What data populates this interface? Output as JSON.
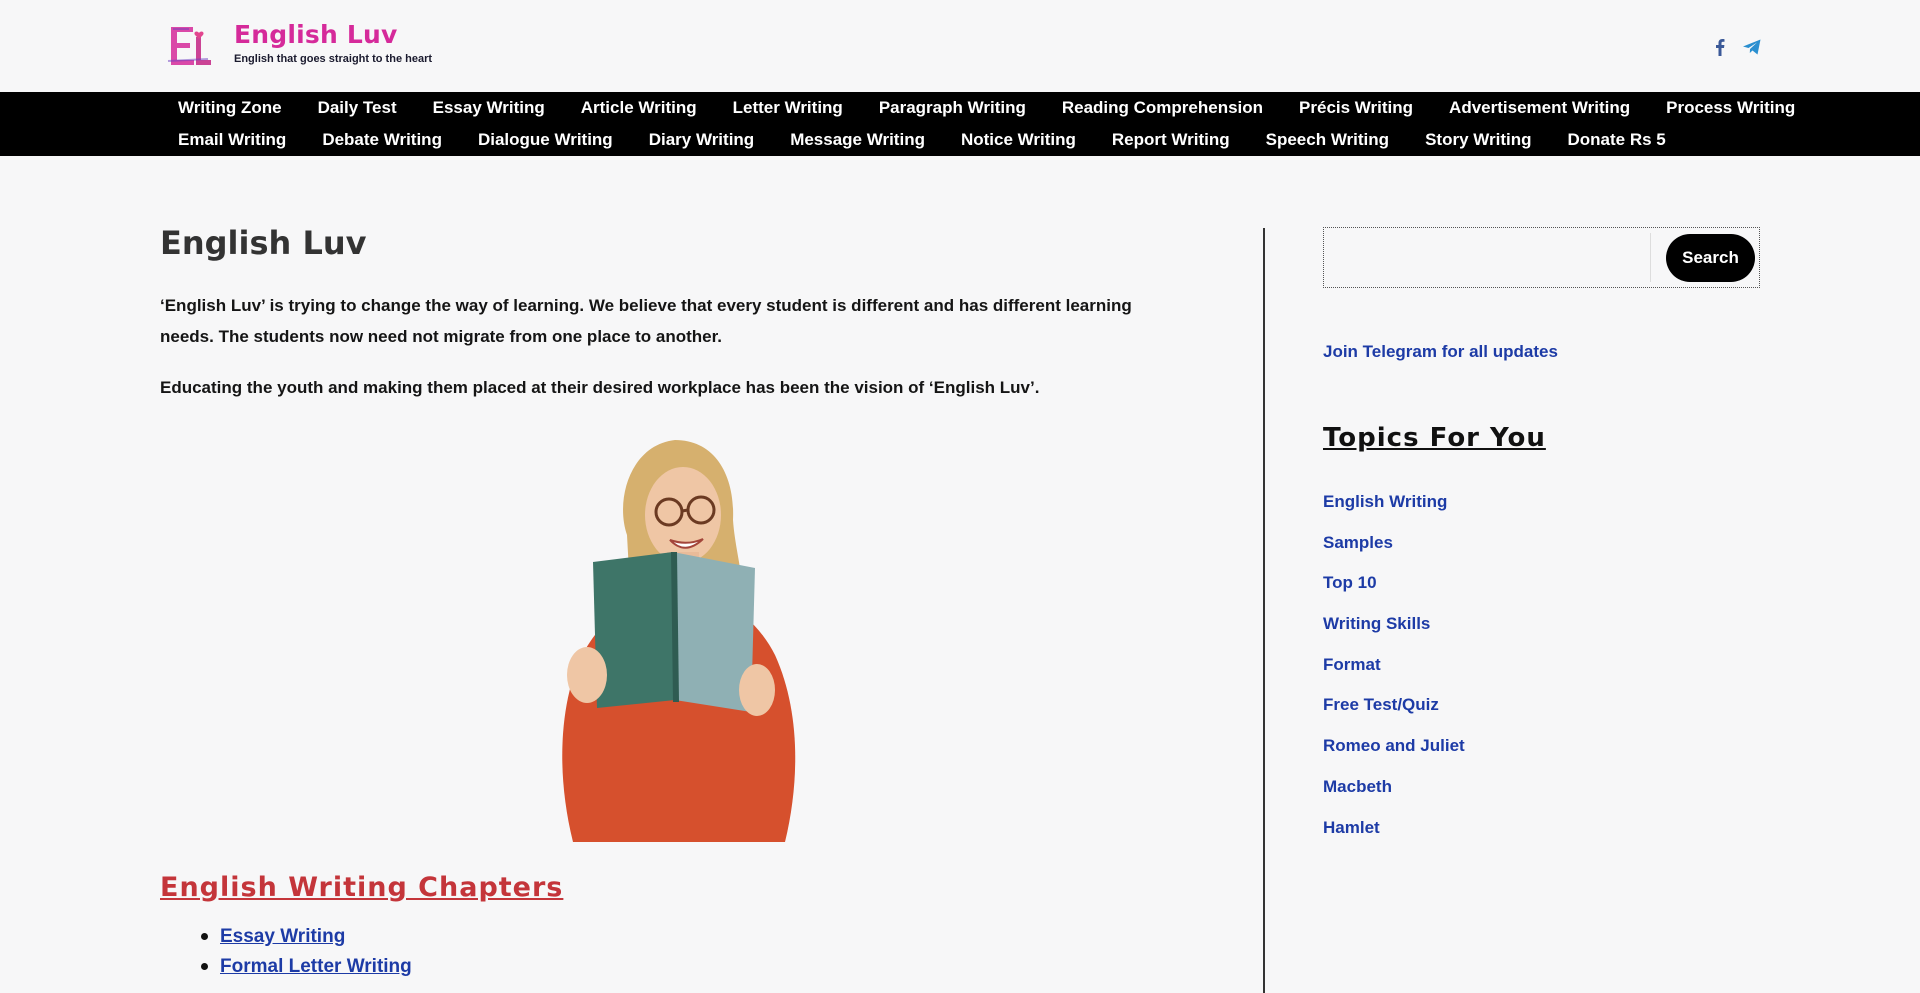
{
  "header": {
    "site_title": "English Luv",
    "tagline": "English that goes straight to the heart",
    "logo_icon": "english-luv-logo",
    "social": [
      {
        "name": "facebook-icon",
        "color": "#3b5998"
      },
      {
        "name": "telegram-icon",
        "color": "#2a8fd0"
      }
    ],
    "brand_color": "#d52a9a"
  },
  "nav": {
    "row1": [
      "Writing Zone",
      "Daily Test",
      "Essay Writing",
      "Article Writing",
      "Letter Writing",
      "Paragraph Writing",
      "Reading Comprehension",
      "Précis Writing",
      "Advertisement Writing",
      "Process Writing"
    ],
    "row2": [
      "Email Writing",
      "Debate Writing",
      "Dialogue Writing",
      "Diary Writing",
      "Message Writing",
      "Notice Writing",
      "Report Writing",
      "Speech Writing",
      "Story Writing",
      "Donate Rs 5"
    ]
  },
  "main": {
    "title": "English Luv",
    "paragraph1": "‘English Luv’ is trying to change the way of learning. We believe that every student is different and has different learning needs. The students now need not migrate from one place to another.",
    "paragraph2": "Educating the youth and making them placed at their desired workplace has been the vision of ‘English Luv’.",
    "chapters_title": "English Writing Chapters",
    "chapters": [
      "Essay Writing",
      "Formal Letter Writing"
    ],
    "chapters_color": "#c4353a"
  },
  "sidebar": {
    "search_button": "Search",
    "search_placeholder": "",
    "telegram_link": "Join Telegram for all updates",
    "topics_title": "Topics For You",
    "topics": [
      "English Writing",
      "Samples",
      "Top 10",
      "Writing Skills",
      "Format",
      "Free Test/Quiz",
      "Romeo and Juliet",
      "Macbeth",
      "Hamlet"
    ],
    "link_color": "#1d3ba6"
  }
}
